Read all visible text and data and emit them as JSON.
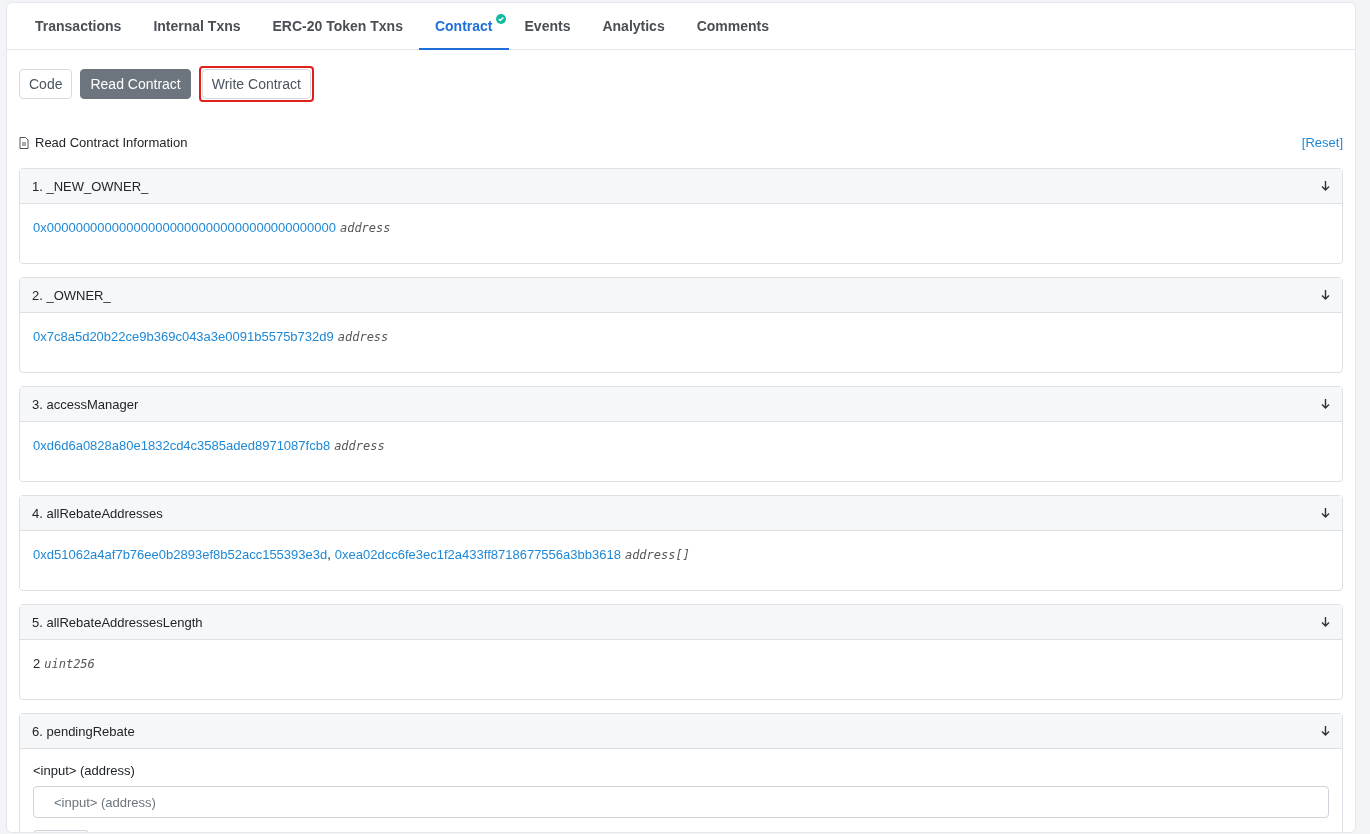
{
  "tabs": [
    {
      "label": "Transactions",
      "selected": false,
      "verified": false
    },
    {
      "label": "Internal Txns",
      "selected": false,
      "verified": false
    },
    {
      "label": "ERC-20 Token Txns",
      "selected": false,
      "verified": false
    },
    {
      "label": "Contract",
      "selected": true,
      "verified": true
    },
    {
      "label": "Events",
      "selected": false,
      "verified": false
    },
    {
      "label": "Analytics",
      "selected": false,
      "verified": false
    },
    {
      "label": "Comments",
      "selected": false,
      "verified": false
    }
  ],
  "subtabs": [
    {
      "label": "Code",
      "selected": false,
      "highlighted": false
    },
    {
      "label": "Read Contract",
      "selected": true,
      "highlighted": false
    },
    {
      "label": "Write Contract",
      "selected": false,
      "highlighted": true
    }
  ],
  "section": {
    "title": "Read Contract Information",
    "reset": "[Reset]"
  },
  "functions": [
    {
      "title": "1. _NEW_OWNER_",
      "kind": "links",
      "values": [
        "0x0000000000000000000000000000000000000000"
      ],
      "type": "address"
    },
    {
      "title": "2. _OWNER_",
      "kind": "links",
      "values": [
        "0x7c8a5d20b22ce9b369c043a3e0091b5575b732d9"
      ],
      "type": "address"
    },
    {
      "title": "3. accessManager",
      "kind": "links",
      "values": [
        "0xd6d6a0828a80e1832cd4c3585aded8971087fcb8"
      ],
      "type": "address"
    },
    {
      "title": "4. allRebateAddresses",
      "kind": "links",
      "values": [
        "0xd51062a4af7b76ee0b2893ef8b52acc155393e3d",
        "0xea02dcc6fe3ec1f2a433ff8718677556a3bb3618"
      ],
      "type": "address[]",
      "separator": ","
    },
    {
      "title": "5. allRebateAddressesLength",
      "kind": "plain",
      "values": [
        "2"
      ],
      "type": "uint256"
    },
    {
      "title": "6. pendingRebate",
      "kind": "input",
      "label": "<input> (address)",
      "placeholder": "<input> (address)"
    }
  ]
}
